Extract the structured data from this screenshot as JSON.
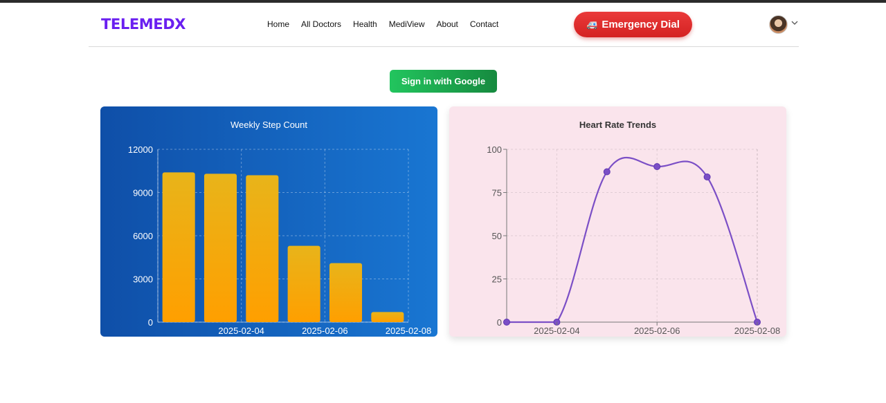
{
  "brand": {
    "logo": "TELEMEDX"
  },
  "nav": {
    "items": [
      {
        "label": "Home"
      },
      {
        "label": "All Doctors"
      },
      {
        "label": "Health"
      },
      {
        "label": "MediView"
      },
      {
        "label": "About"
      },
      {
        "label": "Contact"
      }
    ],
    "emergency_label": "Emergency Dial",
    "emergency_icon": "ambulance-icon"
  },
  "auth": {
    "google_label": "Sign in with Google"
  },
  "colors": {
    "brand": "#6a1ff0",
    "emergency": "#e02d2d",
    "google": "#1aa84f",
    "bar": "#f5a800",
    "line": "#7b4fc6"
  },
  "chart_data": [
    {
      "type": "bar",
      "title": "Weekly Step Count",
      "categories": [
        "2025-02-03",
        "2025-02-04",
        "2025-02-05",
        "2025-02-06",
        "2025-02-07",
        "2025-02-08"
      ],
      "x_tick_labels": [
        "2025-02-04",
        "2025-02-06",
        "2025-02-08"
      ],
      "values": [
        10400,
        10300,
        10200,
        5300,
        4100,
        700
      ],
      "ylim": [
        0,
        12000
      ],
      "y_ticks": [
        0,
        3000,
        6000,
        9000,
        12000
      ],
      "grid": true
    },
    {
      "type": "line",
      "title": "Heart Rate Trends",
      "x": [
        "2025-02-03",
        "2025-02-04",
        "2025-02-05",
        "2025-02-06",
        "2025-02-07",
        "2025-02-08"
      ],
      "x_tick_labels": [
        "2025-02-04",
        "2025-02-06",
        "2025-02-08"
      ],
      "values": [
        0,
        0,
        87,
        90,
        84,
        0
      ],
      "ylim": [
        0,
        100
      ],
      "y_ticks": [
        0,
        25,
        50,
        75,
        100
      ],
      "grid": true
    }
  ]
}
